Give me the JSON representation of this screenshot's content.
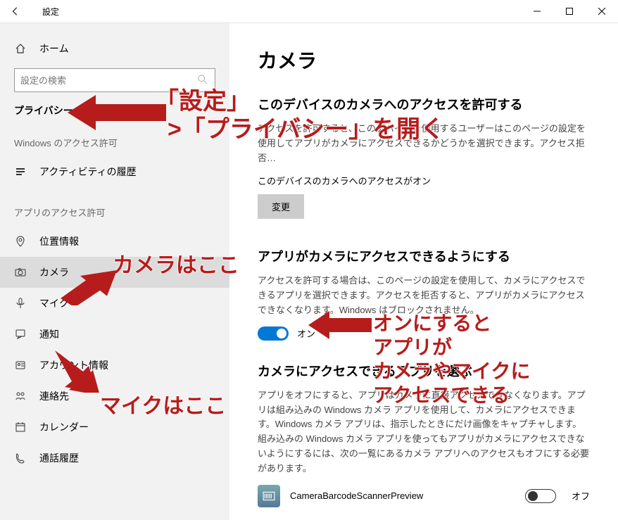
{
  "titlebar": {
    "title": "設定"
  },
  "sidebar": {
    "home": "ホーム",
    "search_placeholder": "設定の検索",
    "section": "プライバシー",
    "group1": "Windows のアクセス許可",
    "group2": "アプリのアクセス許可",
    "items_win": [
      {
        "icon": "history",
        "label": "アクティビティの履歴"
      }
    ],
    "items_app": [
      {
        "icon": "location",
        "label": "位置情報"
      },
      {
        "icon": "camera",
        "label": "カメラ",
        "selected": true
      },
      {
        "icon": "mic",
        "label": "マイク"
      },
      {
        "icon": "bell",
        "label": "通知"
      },
      {
        "icon": "account",
        "label": "アカウント情報"
      },
      {
        "icon": "contacts",
        "label": "連絡先"
      },
      {
        "icon": "calendar",
        "label": "カレンダー"
      },
      {
        "icon": "phone",
        "label": "通話履歴"
      }
    ]
  },
  "content": {
    "heading": "カメラ",
    "h2_device": "このデバイスのカメラへのアクセスを許可する",
    "desc_device": "アクセスを許可すると、このデバイスを使用するユーザーはこのページの設定を使用してアプリがカメラにアクセスできるかどうかを選択できます。アクセス拒否…",
    "status_device": "このデバイスのカメラへのアクセスがオン",
    "change_btn": "変更",
    "h2_apps": "アプリがカメラにアクセスできるようにする",
    "desc_apps": "アクセスを許可する場合は、このページの設定を使用して、カメラにアクセスできるアプリを選択できます。アクセスを拒否すると、アプリがカメラにアクセスできなくなります。Windows はブロックされません。",
    "toggle_on": "オン",
    "h2_choose": "カメラにアクセスできるアプリを選ぶ",
    "desc_choose": "アプリをオフにすると、アプリはカメラに直接アクセスできなくなります。アプリは組み込みの Windows カメラ アプリを使用して、カメラにアクセスできます。Windows カメラ アプリは、指示したときにだけ画像をキャプチャします。組み込みの Windows カメラ アプリを使ってもアプリがカメラにアクセスできないようにするには、次の一覧にあるカメラ アプリへのアクセスもオフにする必要があります。",
    "app_item": {
      "name": "CameraBarcodeScannerPreview",
      "state": "オフ"
    }
  },
  "annotations": {
    "a1_line1": "「設定」",
    "a1_line2": ">「プライバシー」を開く",
    "a2": "カメラはここ",
    "a3": "マイクはここ",
    "a4_line1": "オンにすると",
    "a4_line2": "アプリが",
    "a4_line3": "カメラやマイクに",
    "a4_line4": "アクセスできる"
  }
}
